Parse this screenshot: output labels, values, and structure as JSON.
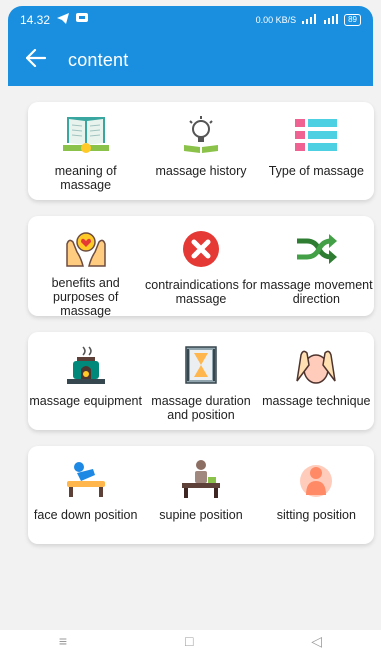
{
  "status": {
    "time": "14.32",
    "network": "0.00 KB/S",
    "battery": "89"
  },
  "appbar": {
    "title": "content"
  },
  "rows": [
    {
      "items": [
        {
          "label": "meaning of massage",
          "icon": "open-book-icon"
        },
        {
          "label": "massage history",
          "icon": "lightbulb-book-icon"
        },
        {
          "label": "Type of massage",
          "icon": "list-icon"
        }
      ]
    },
    {
      "items": [
        {
          "label": "benefits and purposes of massage",
          "icon": "hands-heart-icon"
        },
        {
          "label": "contraindications for massage",
          "icon": "red-cross-icon"
        },
        {
          "label": "massage movement direction",
          "icon": "shuffle-arrows-icon"
        }
      ]
    },
    {
      "items": [
        {
          "label": "massage equipment",
          "icon": "aroma-diffuser-icon"
        },
        {
          "label": "massage duration and position",
          "icon": "hourglass-icon"
        },
        {
          "label": "massage technique",
          "icon": "hands-on-face-icon"
        }
      ]
    },
    {
      "items": [
        {
          "label": "face down position",
          "icon": "person-lying-face-down-icon"
        },
        {
          "label": "supine position",
          "icon": "person-supine-table-icon"
        },
        {
          "label": "sitting position",
          "icon": "person-sitting-icon"
        }
      ]
    }
  ],
  "navbar": {
    "menu": "≡",
    "home": "□",
    "back": "◁"
  }
}
